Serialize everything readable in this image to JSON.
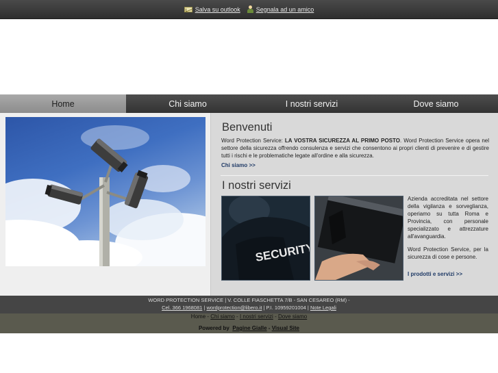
{
  "topbar": {
    "outlook_label": "Salva su outlook",
    "friend_label": "Segnala ad un amico"
  },
  "nav": {
    "items": [
      "Home",
      "Chi siamo",
      "I nostri servizi",
      "Dove siamo"
    ],
    "active": "Home"
  },
  "welcome": {
    "title": "Benvenuti",
    "text_prefix": "Word Protection Service: ",
    "text_bold": "LA VOSTRA SICUREZZA AL PRIMO POSTO",
    "text_rest": ". Word Protection Service opera nel settore della sicurezza offrendo consulenza e servizi che consentono ai propri clienti di prevenire e di gestire tutti i rischi e le problematiche legate all'ordine e alla sicurezza.",
    "more_label": "Chi siamo >>"
  },
  "services": {
    "title": "I nostri servizi",
    "text1": "Azienda accreditata nel settore della vigilanza e sorveglianza, operiamo su tutta Roma e Provincia, con personale specializzato e attrezzature all'avanguardia.",
    "text2": "Word Protection Service, per la sicurezza di cose e persone.",
    "more_label": "I prodotti e servizi >>",
    "security_text": "SECURITY"
  },
  "footer": {
    "line1": "WORD PROTECTION SERVICE | V. COLLE FIASCHETTA 7/B - SAN CESAREO (RM) -",
    "phone": "Cel. 366 1968081",
    "sep1": " | ",
    "email": "wordprotection@libero.it",
    "piva": " | P.I. 10959201004 | ",
    "legal": "Note Legali"
  },
  "bottom_links": {
    "home": "Home",
    "chi_siamo": "Chi siamo",
    "servizi": "I nostri servizi",
    "dove_siamo": "Dove siamo",
    "dash": " - ",
    "powered_by": "Powered by",
    "pagine_gialle": "Pagine Gialle",
    "visual_site": "Visual Site"
  }
}
